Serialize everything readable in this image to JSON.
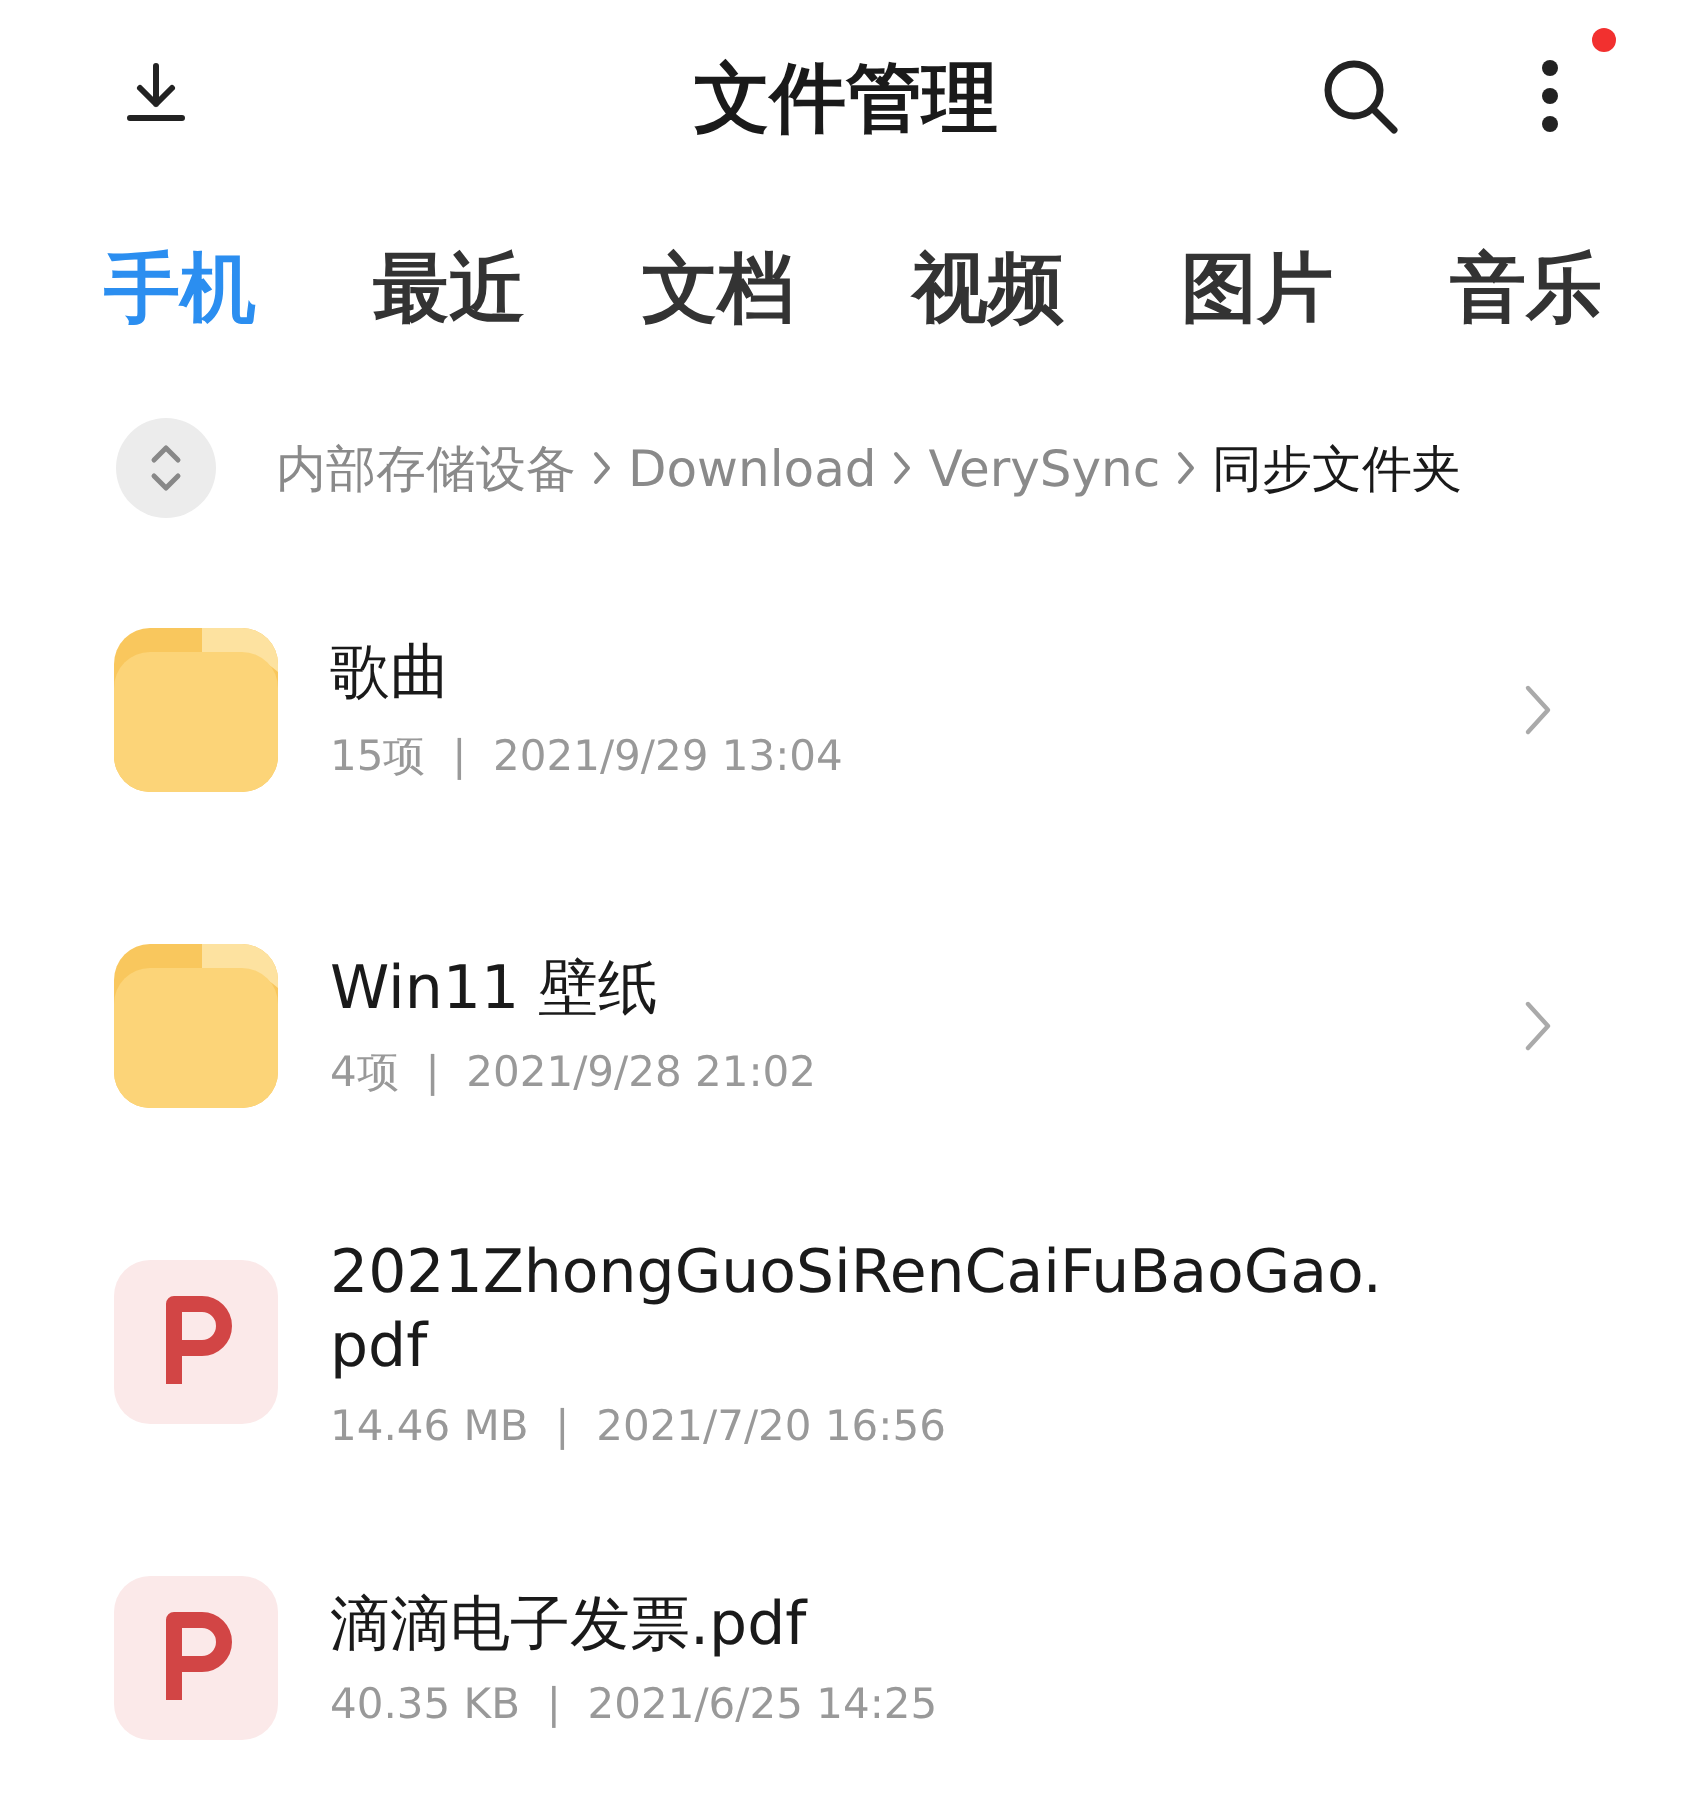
{
  "header": {
    "title": "文件管理",
    "badge": true
  },
  "tabs": [
    {
      "label": "手机",
      "selected": true
    },
    {
      "label": "最近",
      "selected": false
    },
    {
      "label": "文档",
      "selected": false
    },
    {
      "label": "视频",
      "selected": false
    },
    {
      "label": "图片",
      "selected": false
    },
    {
      "label": "音乐",
      "selected": false
    }
  ],
  "breadcrumb": [
    {
      "label": "内部存储设备",
      "selected": false
    },
    {
      "label": "Download",
      "selected": false
    },
    {
      "label": "VerySync",
      "selected": false
    },
    {
      "label": "同步文件夹",
      "selected": true
    }
  ],
  "files": [
    {
      "kind": "folder",
      "name": "歌曲",
      "meta": "15项  |  2021/9/29 13:04"
    },
    {
      "kind": "folder",
      "name": "Win11 壁纸",
      "meta": "4项  |  2021/9/28 21:02"
    },
    {
      "kind": "pdf",
      "name": "2021ZhongGuoSiRenCaiFuBaoGao.pdf",
      "meta": "14.46 MB  |  2021/7/20 16:56"
    },
    {
      "kind": "pdf",
      "name": "滴滴电子发票.pdf",
      "meta": "40.35 KB  |  2021/6/25 14:25"
    }
  ]
}
